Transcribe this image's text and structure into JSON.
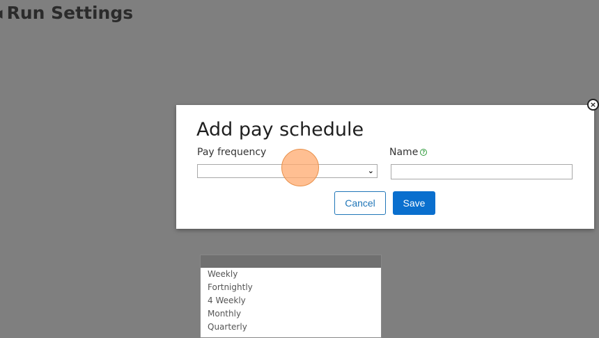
{
  "page": {
    "title": "Run Settings"
  },
  "modal": {
    "title": "Add pay schedule",
    "pay_frequency_label": "Pay frequency",
    "name_label": "Name",
    "pay_frequency_value": "",
    "name_value": "",
    "cancel_label": "Cancel",
    "save_label": "Save",
    "close_label": "×",
    "help_glyph": "?"
  },
  "dropdown": {
    "options": [
      "",
      "Weekly",
      "Fortnightly",
      "4 Weekly",
      "Monthly",
      "Quarterly"
    ]
  },
  "colors": {
    "overlay": "#7f7f7f",
    "primary": "#0a6fce",
    "help": "#2e9a3a"
  }
}
